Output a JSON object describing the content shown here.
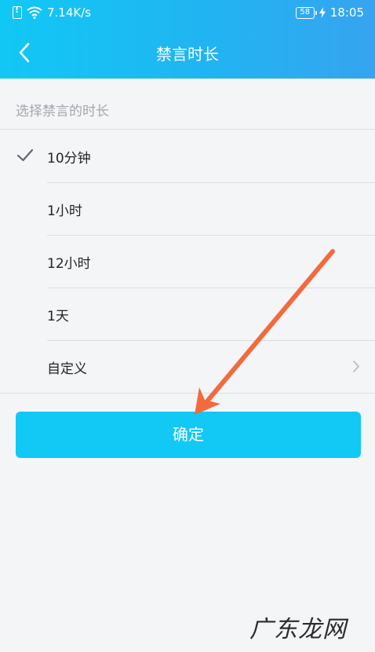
{
  "status_bar": {
    "net_speed": "7.14K/s",
    "battery": "58",
    "time": "18:05",
    "icons": [
      "sim-alert-icon",
      "wifi-icon",
      "battery-icon",
      "charging-icon"
    ]
  },
  "nav": {
    "back_icon": "chevron-left-icon",
    "title": "禁言时长"
  },
  "section_hint": "选择禁言的时长",
  "options": [
    {
      "label": "10分钟",
      "selected": true
    },
    {
      "label": "1小时",
      "selected": false
    },
    {
      "label": "12小时",
      "selected": false
    },
    {
      "label": "1天",
      "selected": false
    },
    {
      "label": "自定义",
      "selected": false,
      "has_chevron": true
    }
  ],
  "confirm_label": "确定",
  "watermark": "广东龙网",
  "colors": {
    "header_start": "#11c8f4",
    "header_end": "#36a4f0",
    "button": "#12c8f5",
    "annotation_arrow": "#f26a3d",
    "check": "#5f6477"
  }
}
